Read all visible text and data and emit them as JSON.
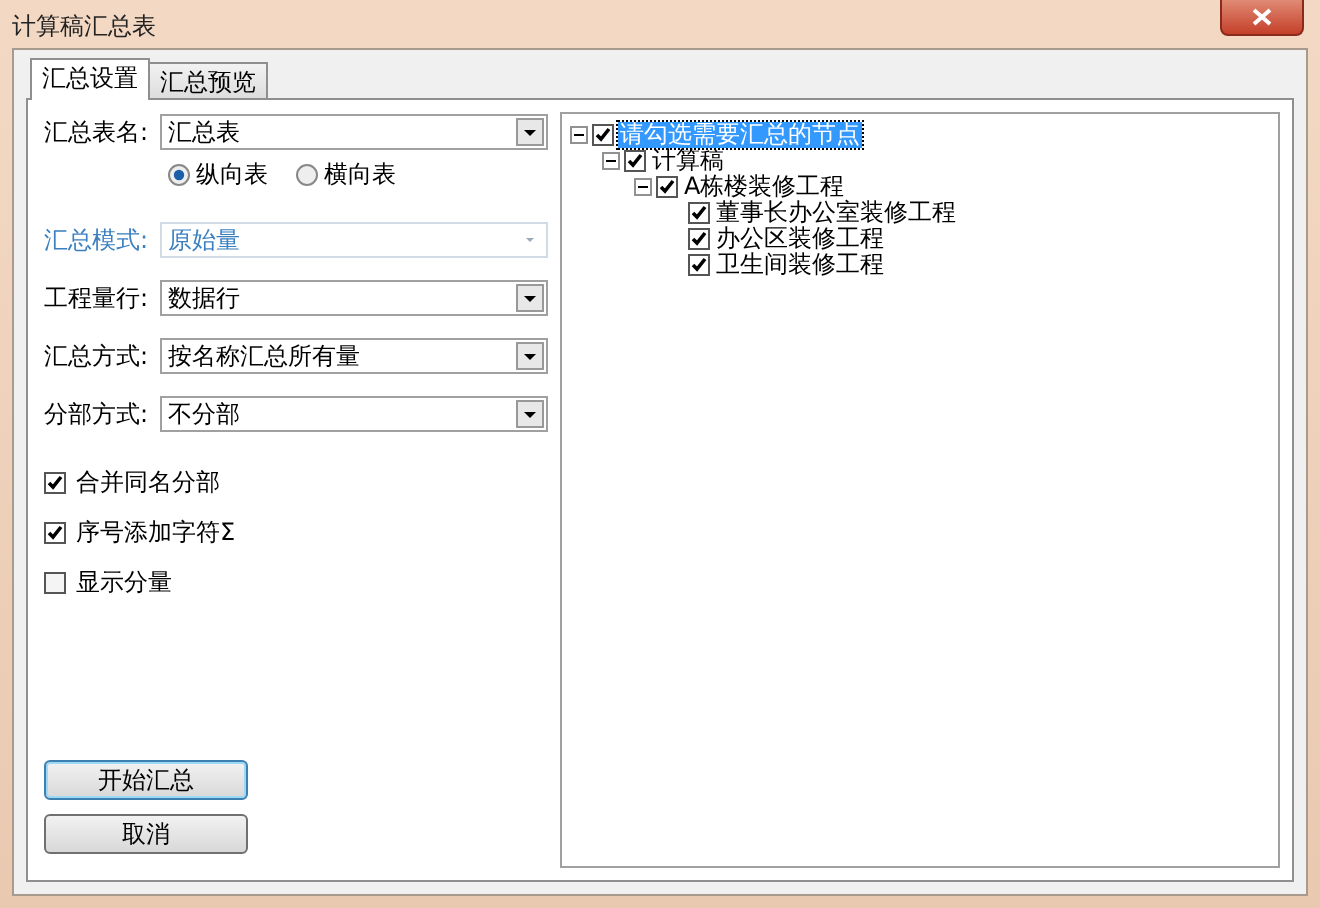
{
  "window": {
    "title": "计算稿汇总表"
  },
  "tabs": [
    {
      "label": "汇总设置",
      "selected": true
    },
    {
      "label": "汇总预览",
      "selected": false
    }
  ],
  "fields": [
    {
      "label": "汇总表名:",
      "value": "汇总表",
      "disabled": false
    },
    {
      "kind": "radios",
      "options": [
        {
          "label": "纵向表",
          "selected": true
        },
        {
          "label": "横向表",
          "selected": false
        }
      ]
    },
    {
      "label": "汇总模式:",
      "value": "原始量",
      "disabled": true
    },
    {
      "label": "工程量行:",
      "value": "数据行",
      "disabled": false
    },
    {
      "label": "汇总方式:",
      "value": "按名称汇总所有量",
      "disabled": false
    },
    {
      "label": "分部方式:",
      "value": "不分部",
      "disabled": false
    }
  ],
  "checkboxes": [
    {
      "label": "合并同名分部",
      "checked": true
    },
    {
      "label": "序号添加字符Σ",
      "checked": true
    },
    {
      "label": "显示分量",
      "checked": false
    }
  ],
  "buttons": [
    {
      "label": "开始汇总",
      "default": true
    },
    {
      "label": "取消",
      "default": false
    }
  ],
  "tree": [
    {
      "label": "请勾选需要汇总的节点",
      "checked": true,
      "expanded": true,
      "selected": true,
      "children": [
        {
          "label": "计算稿",
          "checked": true,
          "expanded": true,
          "selected": false,
          "children": [
            {
              "label": "A栋楼装修工程",
              "checked": true,
              "expanded": true,
              "selected": false,
              "children": [
                {
                  "label": "董事长办公室装修工程",
                  "checked": true,
                  "selected": false
                },
                {
                  "label": "办公区装修工程",
                  "checked": true,
                  "selected": false
                },
                {
                  "label": "卫生间装修工程",
                  "checked": true,
                  "selected": false
                }
              ]
            }
          ]
        }
      ]
    }
  ]
}
